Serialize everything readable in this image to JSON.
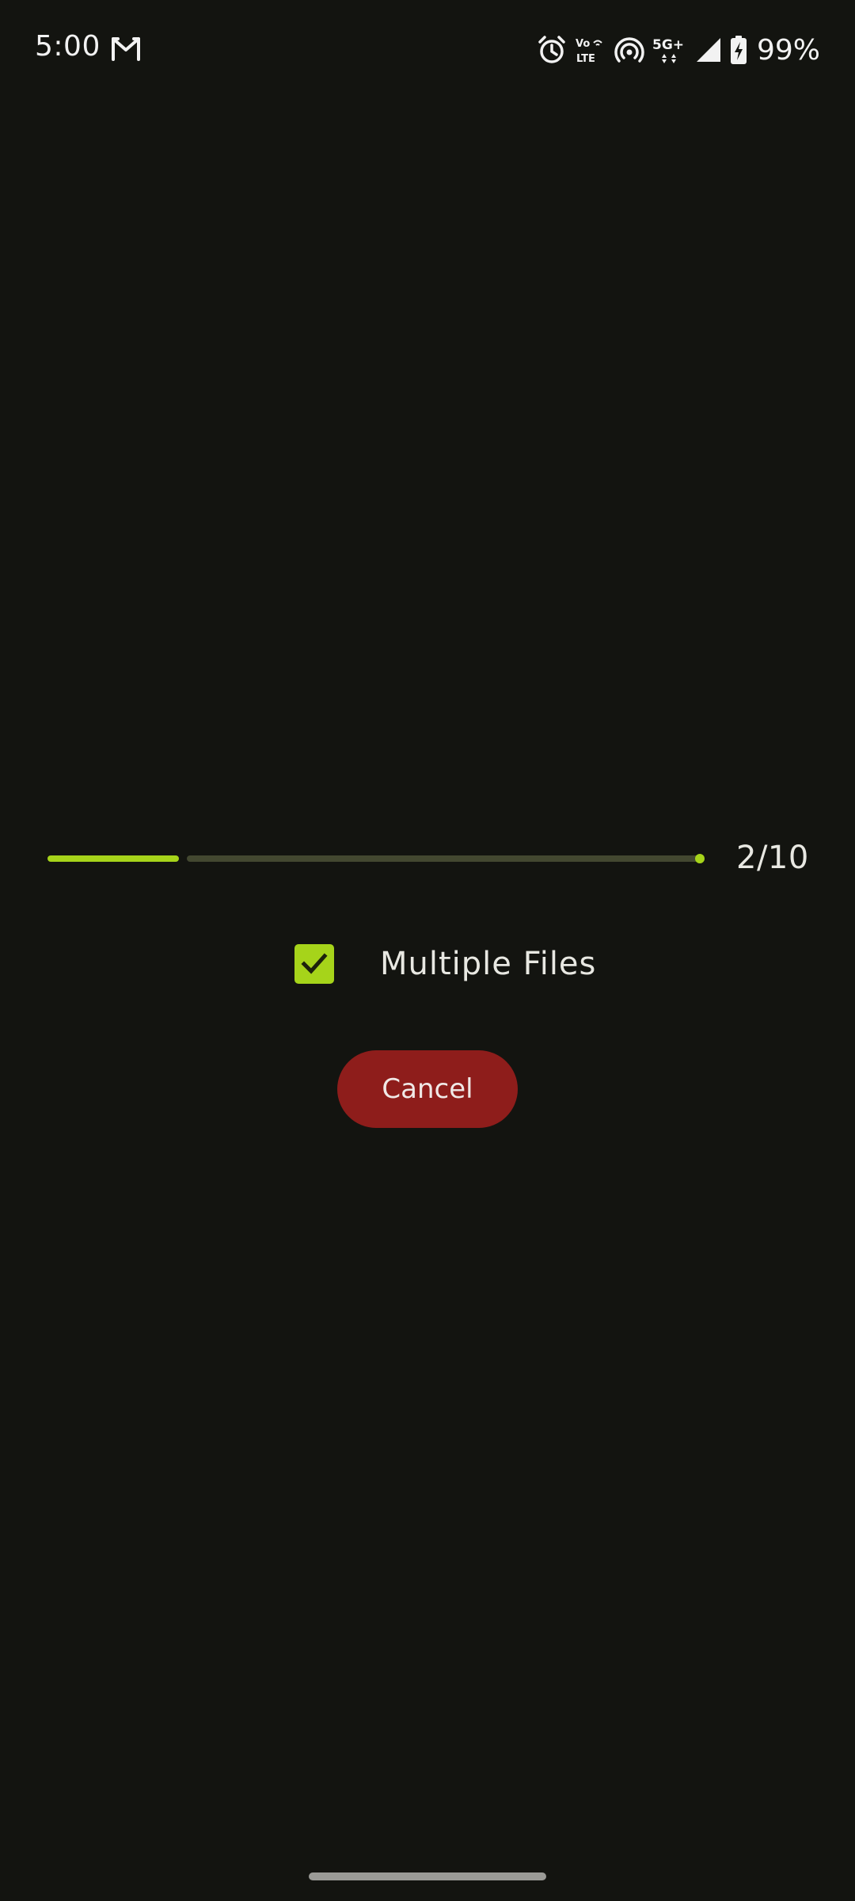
{
  "status_bar": {
    "time": "5:00",
    "battery_percent": "99%",
    "network_label": "5G+",
    "volte_label": "Vo LTE",
    "icons": [
      "gmail-icon",
      "alarm-icon",
      "volte-icon",
      "hotspot-icon",
      "5g-icon",
      "signal-icon",
      "battery-charging-icon"
    ]
  },
  "progress": {
    "current": 2,
    "total": 10,
    "label": "2/10",
    "fraction": 0.2
  },
  "options": {
    "multiple_files_label": "Multiple Files",
    "multiple_files_checked": true
  },
  "actions": {
    "cancel_label": "Cancel"
  },
  "colors": {
    "background": "#131410",
    "accent": "#a6d41a",
    "track": "#434830",
    "cancel": "#8e1d1b",
    "text": "#e8e8e2"
  }
}
